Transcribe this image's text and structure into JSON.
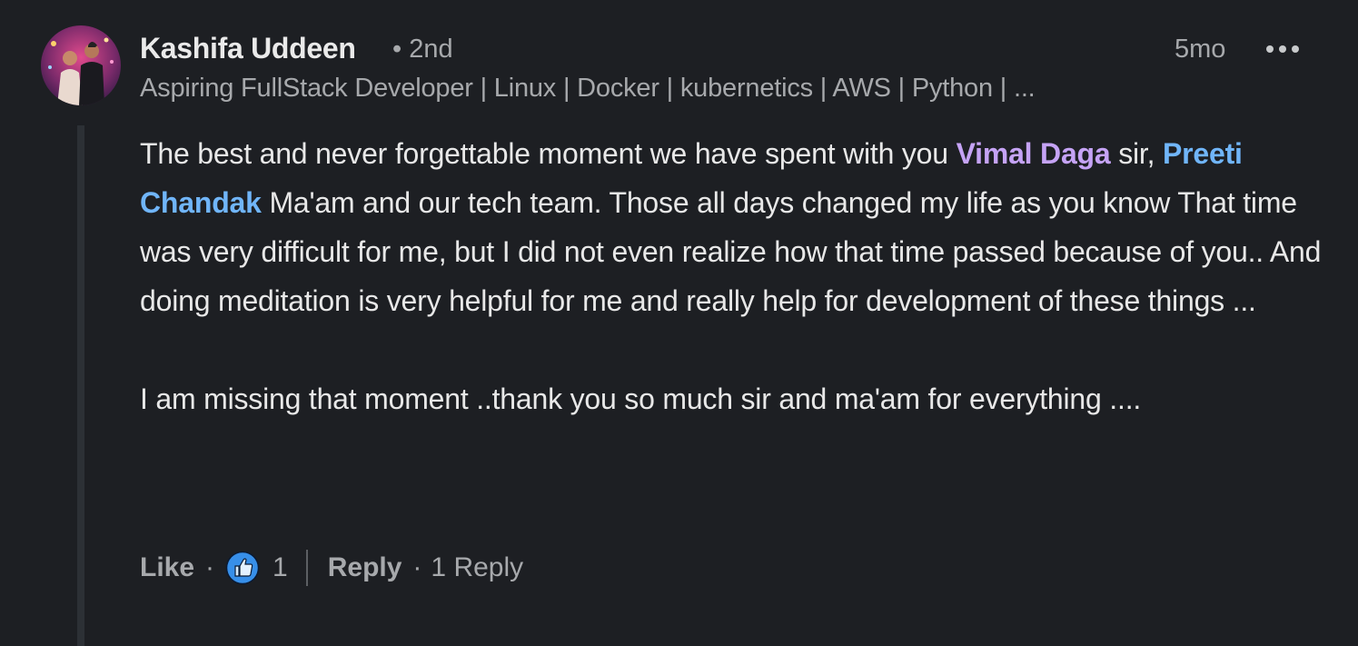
{
  "author": {
    "name": "Kashifa Uddeen",
    "degree": "• 2nd",
    "headline": "Aspiring FullStack Developer | Linux | Docker | kubernetics | AWS | Python | ..."
  },
  "meta": {
    "timestamp": "5mo",
    "more_icon": "ellipsis-icon"
  },
  "comment": {
    "line1_before": "The best and never forgettable moment we have spent with you ",
    "mention_1": "Vimal Daga",
    "line1_between": " sir, ",
    "mention_2": "Preeti Chandak",
    "line1_after": " Ma'am and our tech team. Those all days changed my life as you know That time was very difficult for me, but I did not even realize how that time passed because of you.. And doing meditation is very helpful for me and really help for development of these things ...",
    "paragraph_2": "I am missing that moment ..thank you so much sir and ma'am for everything ...."
  },
  "actions": {
    "like_label": "Like",
    "separator": "·",
    "reaction_icon": "thumbs-up-icon",
    "reaction_count": "1",
    "reply_label": "Reply",
    "reply_count": "1 Reply"
  },
  "colors": {
    "background": "#1d1f23",
    "mention_1": "#c5a3f5",
    "mention_2": "#70b5f9",
    "reaction_blue": "#378fe9"
  }
}
